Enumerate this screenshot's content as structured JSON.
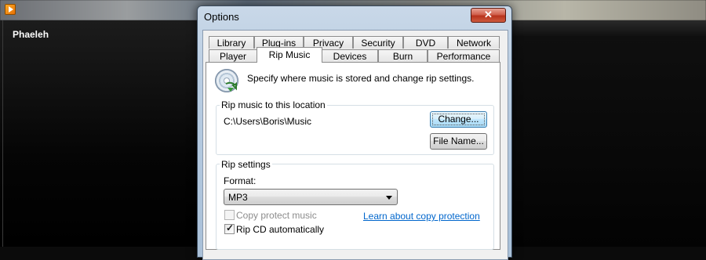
{
  "player": {
    "now_playing": "Phaeleh"
  },
  "dialog": {
    "title": "Options",
    "close_glyph": "✕",
    "tabs_row1": [
      "Library",
      "Plug-ins",
      "Privacy",
      "Security",
      "DVD",
      "Network"
    ],
    "tabs_row2": [
      "Player",
      "Rip Music",
      "Devices",
      "Burn",
      "Performance"
    ],
    "active_tab": "Rip Music",
    "intro": "Specify where music is stored and change rip settings.",
    "location_group": {
      "label": "Rip music to this location",
      "path": "C:\\Users\\Boris\\Music",
      "change_button": "Change...",
      "filename_button": "File Name..."
    },
    "rip_settings": {
      "label": "Rip settings",
      "format_label": "Format:",
      "format_value": "MP3",
      "copy_protect_label": "Copy protect music",
      "copy_protect_checked": false,
      "copy_protect_enabled": false,
      "copy_protection_link": "Learn about copy protection",
      "rip_cd_label": "Rip CD automatically",
      "rip_cd_checked": true
    }
  },
  "icons": {
    "app_icon": "media-player-icon",
    "close": "close-icon",
    "rip": "rip-cd-icon",
    "dropdown": "chevron-down-icon",
    "check": "checkmark-icon"
  },
  "colors": {
    "link": "#0066cc",
    "close_button": "#c7432b",
    "focus_button": "#bee6fd"
  }
}
